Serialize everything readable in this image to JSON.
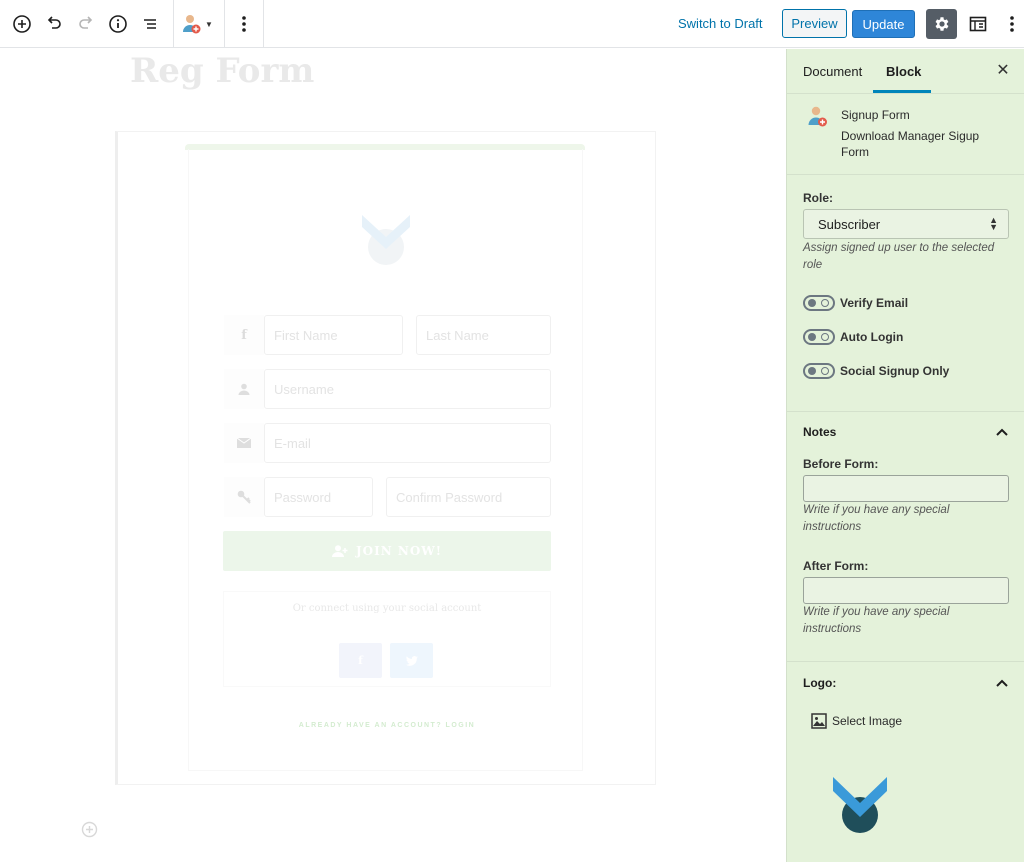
{
  "toolbar": {
    "add_block": "add-block-icon",
    "undo": "undo-icon",
    "redo": "redo-icon",
    "info": "info-icon",
    "outline": "list-view-icon",
    "block_switcher": "signup-form-block-icon",
    "more": "more-vertical-icon",
    "switch_to_draft": "Switch to Draft",
    "preview": "Preview",
    "update": "Update",
    "settings": "gear-icon",
    "layout": "layout-icon",
    "options": "more-vertical-icon"
  },
  "editor": {
    "post_title": "Reg Form",
    "form": {
      "first_name_placeholder": "First Name",
      "last_name_placeholder": "Last Name",
      "username_placeholder": "Username",
      "email_placeholder": "E-mail",
      "password_placeholder": "Password",
      "confirm_password_placeholder": "Confirm Password",
      "join_label": "JOIN NOW!",
      "social_text": "Or connect using your social account",
      "already_text": "ALREADY HAVE AN ACCOUNT? LOGIN"
    }
  },
  "sidebar": {
    "tabs": [
      {
        "label": "Document",
        "active": false
      },
      {
        "label": "Block",
        "active": true
      }
    ],
    "close": "close-icon",
    "block": {
      "title": "Signup Form",
      "description": "Download Manager Sigup Form"
    },
    "role": {
      "label": "Role:",
      "value": "Subscriber",
      "help": "Assign signed up user to the selected role"
    },
    "toggles": [
      {
        "label": "Verify Email",
        "on": false
      },
      {
        "label": "Auto Login",
        "on": false
      },
      {
        "label": "Social Signup Only",
        "on": false
      }
    ],
    "notes": {
      "title": "Notes",
      "before_label": "Before Form:",
      "before_value": "",
      "before_help": "Write if you have any special instructions",
      "after_label": "After Form:",
      "after_value": "",
      "after_help": "Write if you have any special instructions"
    },
    "logo": {
      "title": "Logo:",
      "select_image": "Select Image"
    }
  },
  "colors": {
    "accent": "#0073aa",
    "update_button": "#2e86d8",
    "sidebar_bg": "#e4f2da",
    "logo_light": "#3a9ad9",
    "logo_dark": "#1f4e5a"
  }
}
